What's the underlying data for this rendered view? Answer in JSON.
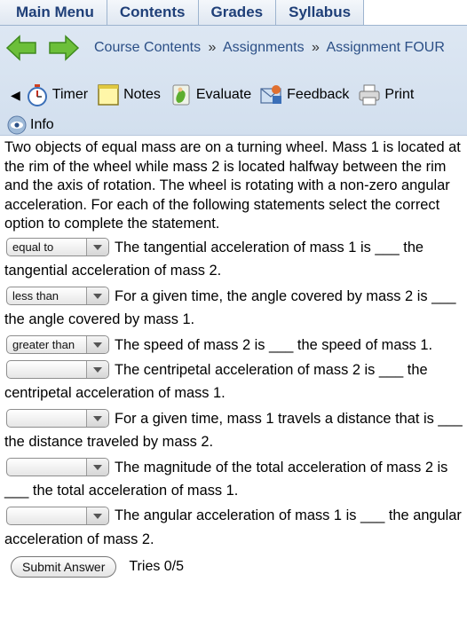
{
  "menu": {
    "tabs": [
      {
        "label": "Main Menu"
      },
      {
        "label": "Contents"
      },
      {
        "label": "Grades"
      },
      {
        "label": "Syllabus"
      }
    ]
  },
  "breadcrumb": {
    "items": [
      "Course Contents",
      "Assignments",
      "Assignment FOUR"
    ],
    "separator": "»"
  },
  "tools": {
    "timer": "Timer",
    "notes": "Notes",
    "evaluate": "Evaluate",
    "feedback": "Feedback",
    "print": "Print",
    "info": "Info"
  },
  "problem": {
    "intro": "Two objects of equal mass are on a turning wheel. Mass 1 is located at the rim of the wheel while mass 2 is located halfway between the rim and the axis of rotation. The wheel is rotating with a non-zero angular acceleration. For each of the following statements select the correct option to complete the statement.",
    "statements": [
      {
        "selected": "equal to",
        "text": "The tangential acceleration of mass 1 is ___ the tangential acceleration of mass 2."
      },
      {
        "selected": "less than",
        "text": "For a given time, the angle covered by mass 2 is ___ the angle covered by mass 1."
      },
      {
        "selected": "greater than",
        "text": "The speed of mass 2 is ___ the speed of mass 1."
      },
      {
        "selected": "",
        "text": "The centripetal acceleration of mass 2 is ___ the centripetal acceleration of mass 1."
      },
      {
        "selected": "",
        "text": "For a given time, mass 1 travels a distance that is ___ the distance traveled by mass 2."
      },
      {
        "selected": "",
        "text": "The magnitude of the total acceleration of mass 2 is ___ the total acceleration of mass 1."
      },
      {
        "selected": "",
        "text": "The angular acceleration of mass 1 is ___ the angular acceleration of mass 2."
      }
    ]
  },
  "submit": {
    "label": "Submit Answer",
    "tries": "Tries 0/5"
  },
  "colors": {
    "menu_text": "#1f3f78",
    "breadcrumb_link": "#2b4f86",
    "nav_bg": "#d8e3f0"
  }
}
